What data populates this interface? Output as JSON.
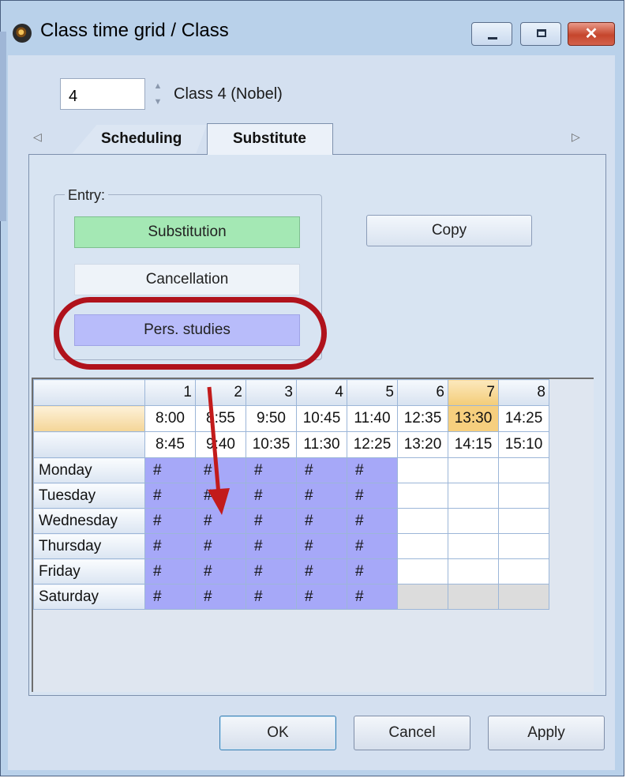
{
  "window": {
    "title": "Class time grid / Class"
  },
  "class_selector": {
    "number_value": "4",
    "class_label": "Class 4 (Nobel)"
  },
  "tabs": [
    {
      "label": "Scheduling"
    },
    {
      "label": "Substitute"
    }
  ],
  "entry": {
    "legend": "Entry:",
    "substitution_label": "Substitution",
    "cancellation_label": "Cancellation",
    "pers_studies_label": "Pers. studies",
    "copy_label": "Copy"
  },
  "grid": {
    "columns": [
      "1",
      "2",
      "3",
      "4",
      "5",
      "6",
      "7",
      "8"
    ],
    "start_times": [
      "8:00",
      "8:55",
      "9:50",
      "10:45",
      "11:40",
      "12:35",
      "13:30",
      "14:25"
    ],
    "end_times": [
      "8:45",
      "9:40",
      "10:35",
      "11:30",
      "12:25",
      "13:20",
      "14:15",
      "15:10"
    ],
    "selected_column": "7",
    "rows": [
      {
        "day": "Monday",
        "cells": [
          "#",
          "#",
          "#",
          "#",
          "#",
          "",
          "",
          ""
        ]
      },
      {
        "day": "Tuesday",
        "cells": [
          "#",
          "#",
          "#",
          "#",
          "#",
          "",
          "",
          ""
        ]
      },
      {
        "day": "Wednesday",
        "cells": [
          "#",
          "#",
          "#",
          "#",
          "#",
          "",
          "",
          ""
        ]
      },
      {
        "day": "Thursday",
        "cells": [
          "#",
          "#",
          "#",
          "#",
          "#",
          "",
          "",
          ""
        ]
      },
      {
        "day": "Friday",
        "cells": [
          "#",
          "#",
          "#",
          "#",
          "#",
          "",
          "",
          ""
        ]
      },
      {
        "day": "Saturday",
        "cells": [
          "#",
          "#",
          "#",
          "#",
          "#",
          "",
          "",
          ""
        ]
      }
    ]
  },
  "buttons": {
    "ok": "OK",
    "cancel": "Cancel",
    "apply": "Apply"
  },
  "colors": {
    "pers_studies": "#a6a8f8",
    "substitution": "#a4e8b4",
    "highlight": "#b0121c",
    "selected_period": "#f6cf7e"
  }
}
